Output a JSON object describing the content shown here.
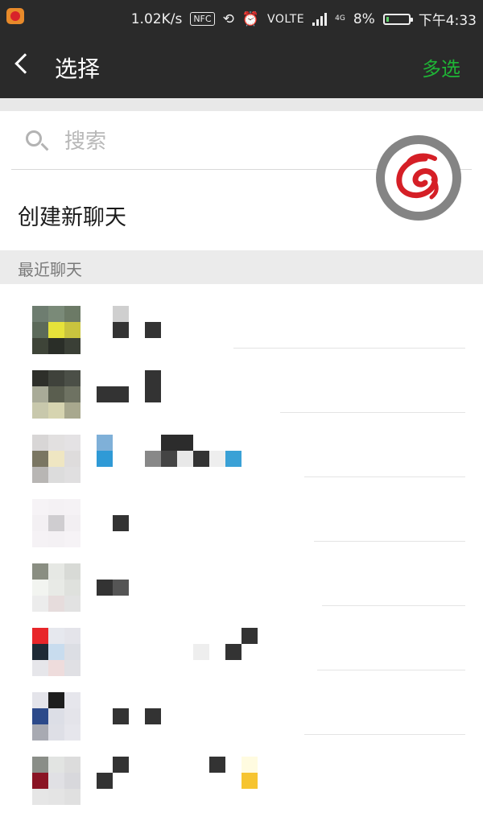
{
  "status_bar": {
    "speed": "1.02K/s",
    "nfc": "NFC",
    "volte": "VOLTE",
    "network": "4G",
    "battery": "8%",
    "time": "下午4:33"
  },
  "header": {
    "title": "选择",
    "multi_select": "多选"
  },
  "search": {
    "placeholder": "搜索",
    "value": ""
  },
  "new_chat": "创建新聊天",
  "recent_header": "最近聊天",
  "colors": {
    "header_bg": "#2a2a2a",
    "accent_green": "#1fb436",
    "section_bg": "#ebebeb"
  },
  "icons": {
    "back": "back-arrow-icon",
    "search": "search-icon",
    "float_badge": "app-logo-icon"
  }
}
